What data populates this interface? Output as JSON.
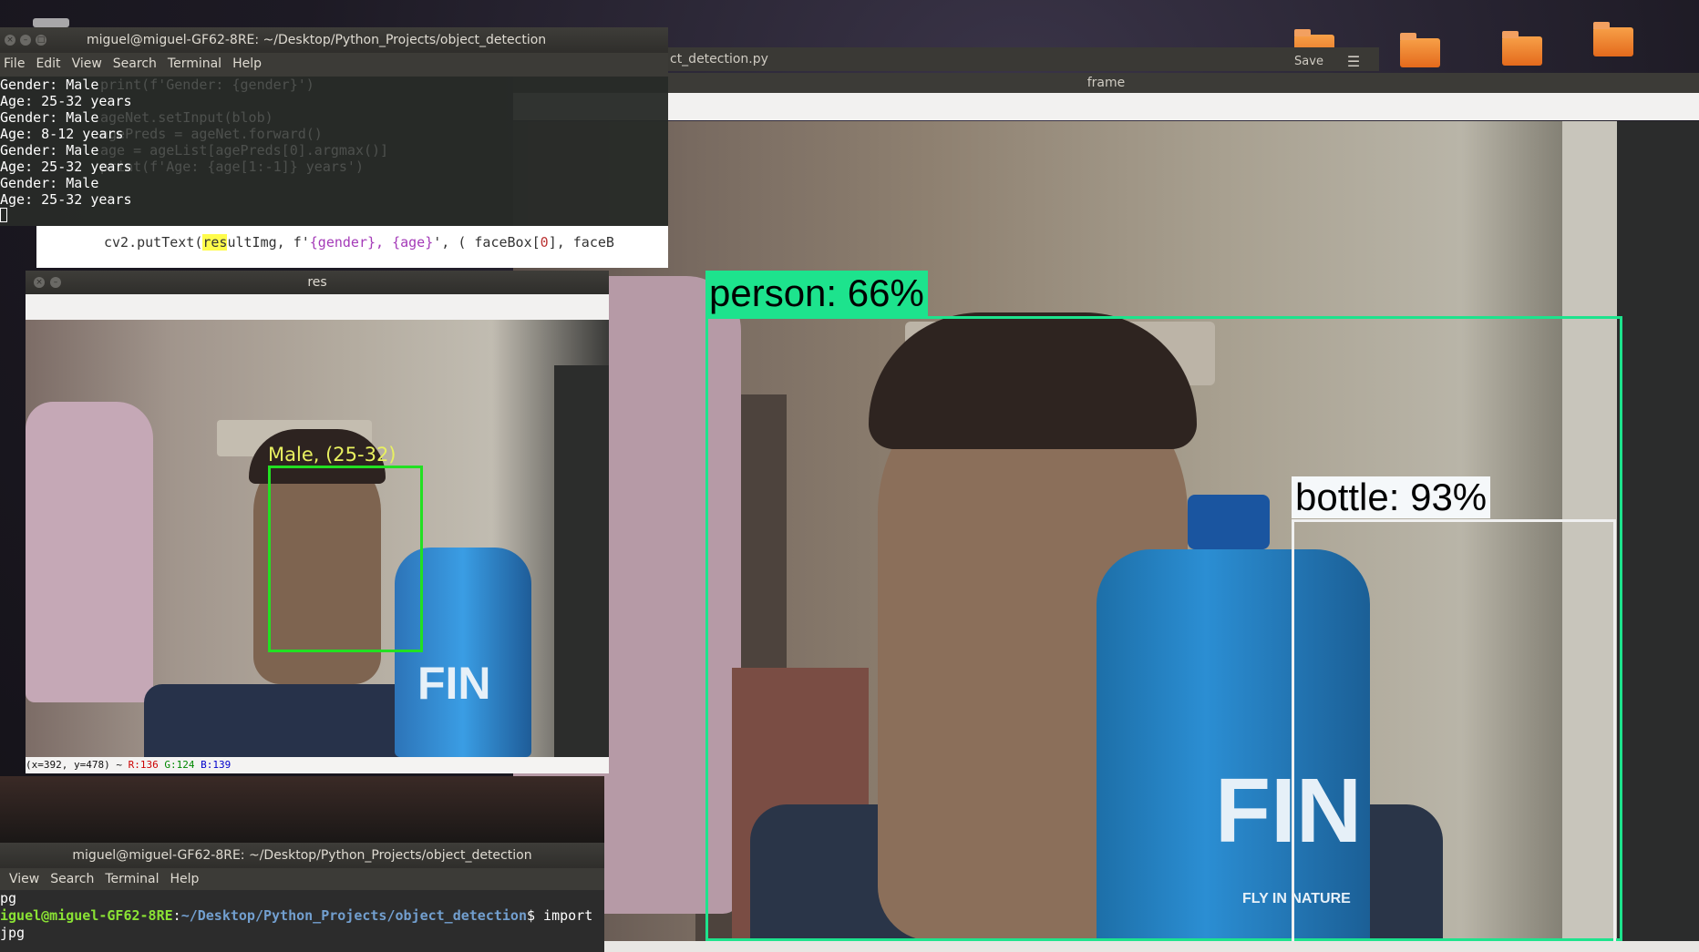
{
  "editor": {
    "tab_title": "ct_detection.py",
    "save_label": "Save",
    "menu_icon": "hamburger-icon",
    "code_line": {
      "p1": "cv2.putText(",
      "p2": "res",
      "p3": "ultImg, f'",
      "p4": "{gender}, {age}",
      "p5": "', ( faceBox[",
      "p6": "0",
      "p7": "], faceB"
    },
    "ghost_lines": [
      "print(f'Gender: {gender}')",
      "",
      "ageNet.setInput(blob)",
      "agePreds = ageNet.forward()",
      "age = ageList[agePreds[0].argmax()]",
      "print(f'Age: {age[1:-1]} years')"
    ]
  },
  "frame_window": {
    "title": "frame",
    "detections": {
      "person_label": "person: 66%",
      "bottle_label": "bottle: 93%"
    },
    "bottle_brand": "FIN",
    "bottle_sub": "FLY IN NATURE"
  },
  "terminal_top": {
    "title": "miguel@miguel-GF62-8RE: ~/Desktop/Python_Projects/object_detection",
    "menu": [
      "File",
      "Edit",
      "View",
      "Search",
      "Terminal",
      "Help"
    ],
    "lines": [
      "Gender: Male",
      "Age: 25-32 years",
      "Gender: Male",
      "Age: 8-12 years",
      "Gender: Male",
      "Age: 25-32 years",
      "Gender: Male",
      "Age: 25-32 years"
    ]
  },
  "res_window": {
    "title": "res",
    "face_label": "Male, (25-32)",
    "bottle_brand": "FIN",
    "status": {
      "coords": "(x=392, y=478) ~ ",
      "r": "R:136",
      "g": "G:124",
      "b": "B:139"
    }
  },
  "terminal_bottom": {
    "title": "miguel@miguel-GF62-8RE: ~/Desktop/Python_Projects/object_detection",
    "menu": [
      "View",
      "Search",
      "Terminal",
      "Help"
    ],
    "line1": "pg",
    "prompt_user": "iguel@miguel-GF62-8RE",
    "prompt_sep": ":",
    "prompt_path": "~/Desktop/Python_Projects/object_detection",
    "prompt_cmd": "$ import",
    "line3": "jpg"
  },
  "colors": {
    "detection_green": "#1de38d",
    "face_box_green": "#00ff00",
    "face_label_yellow": "#e8f060"
  }
}
